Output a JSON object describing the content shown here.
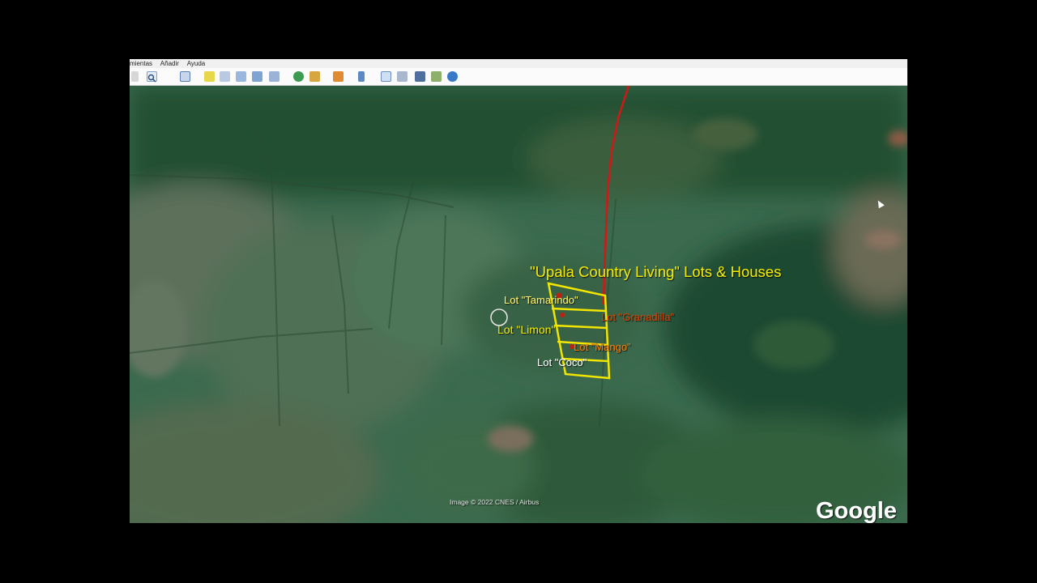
{
  "menu": {
    "items": [
      "mientas",
      "Añadir",
      "Ayuda"
    ]
  },
  "toolbar": {
    "icons": [
      "sidebar-toggle-icon",
      "search-icon",
      "sidebar-icon",
      "placemark-icon",
      "polygon-icon",
      "path-icon",
      "overlay-icon",
      "tour-icon",
      "historical-imagery-icon",
      "sunlight-icon",
      "planets-icon",
      "ruler-icon",
      "email-icon",
      "print-icon",
      "save-image-icon",
      "maps-icon",
      "earth-gallery-icon"
    ]
  },
  "map": {
    "title": "\"Upala Country Living\" Lots & Houses",
    "lots": {
      "tamarindo": "Lot \"Tamarindo\"",
      "granadilla": "Lot \"Granadilla\"",
      "limon": "Lot \"Limon\"",
      "mango": "Lot \"Mango\"",
      "coco": "Lot \"Coco\""
    },
    "attribution": "Image © 2022 CNES / Airbus",
    "logo": "Google"
  },
  "colors": {
    "boundary": "#f2e600",
    "route": "#d01818",
    "title_text": "#f0e800",
    "red_label": "#d84000",
    "orange_label": "#ff7a00"
  }
}
